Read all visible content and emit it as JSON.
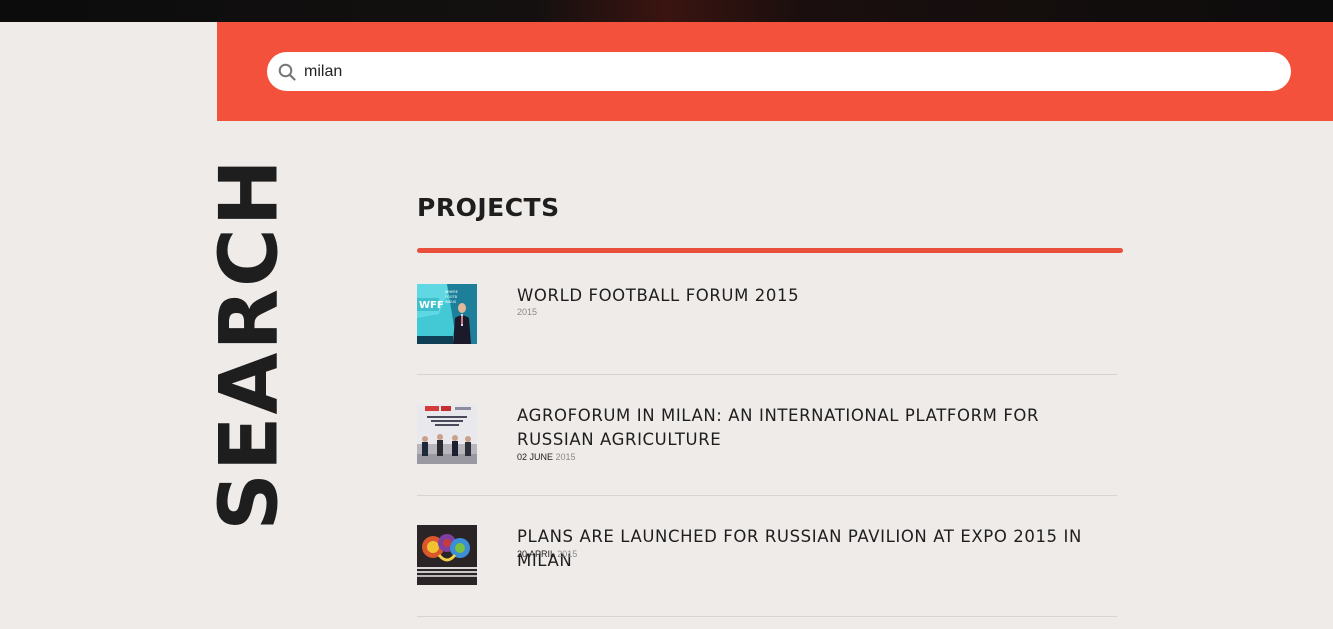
{
  "search": {
    "value": "milan",
    "icon": "search-icon"
  },
  "page": {
    "vertical_title": "SEARCH"
  },
  "section": {
    "title": "PROJECTS"
  },
  "colors": {
    "accent": "#f4513d",
    "background": "#efebe9",
    "text": "#1e1e1e"
  },
  "results": [
    {
      "title": "WORLD FOOTBALL FORUM 2015",
      "date_day": "",
      "date_year": "2015"
    },
    {
      "title": "AGROFORUM IN MILAN: AN INTERNATIONAL PLATFORM FOR RUSSIAN AGRICULTURE",
      "date_day": "02 JUNE",
      "date_year": "2015"
    },
    {
      "title": "PLANS ARE LAUNCHED FOR RUSSIAN PAVILION AT EXPO 2015 IN MILAN",
      "date_day": "20 APRIL",
      "date_year": "2015"
    }
  ]
}
